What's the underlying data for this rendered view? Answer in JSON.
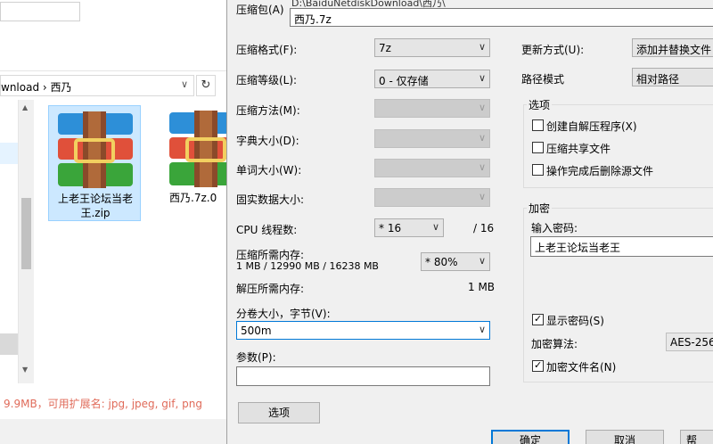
{
  "explorer": {
    "address_path": "wnload  ›  西乃",
    "address_chevron": "∨",
    "refresh_icon": "↻",
    "files": [
      {
        "name": "上老王论坛当老王.zip",
        "selected": true,
        "icon": "archive-icon"
      },
      {
        "name": "西乃.7z.0",
        "selected": false,
        "icon": "archive-icon"
      }
    ],
    "bottom_text": "9.9MB，可用扩展名: jpg, jpeg, gif, png",
    "colors": {
      "accent": "#e06b5a",
      "select_bg": "#cce8ff"
    }
  },
  "dialog": {
    "archive_label": "压缩包(A)",
    "archive_path_hint": "D:\\BaiduNetdiskDownload\\西乃\\",
    "archive_name": "西乃.7z",
    "left": {
      "format_label": "压缩格式(F):",
      "format_value": "7z",
      "level_label": "压缩等级(L):",
      "level_value": "0 - 仅存储",
      "method_label": "压缩方法(M):",
      "dict_label": "字典大小(D):",
      "word_label": "单词大小(W):",
      "solid_label": "固实数据大小:",
      "cpu_label": "CPU 线程数:",
      "cpu_value": "* 16",
      "cpu_total": "/ 16",
      "mem_label": "压缩所需内存:",
      "mem_detail": "1 MB / 12990 MB / 16238 MB",
      "mem_value": "* 80%",
      "decomp_label": "解压所需内存:",
      "decomp_value": "1 MB",
      "volume_label": "分卷大小，字节(V):",
      "volume_value": "500m",
      "params_label": "参数(P):",
      "params_value": "",
      "options_button": "选项"
    },
    "right": {
      "update_label": "更新方式(U):",
      "update_value": "添加并替换文件",
      "path_label": "路径模式",
      "path_value": "相对路径",
      "options_group": "选项",
      "opt_sfx": "创建自解压程序(X)",
      "opt_shared": "压缩共享文件",
      "opt_delete": "操作完成后删除源文件",
      "encrypt_group": "加密",
      "password_label": "输入密码:",
      "password_value": "上老王论坛当老王",
      "show_password": "显示密码(S)",
      "algo_label": "加密算法:",
      "algo_value": "AES-256",
      "encrypt_names": "加密文件名(N)"
    },
    "buttons": {
      "ok": "确定",
      "cancel": "取消",
      "help": "帮"
    }
  }
}
